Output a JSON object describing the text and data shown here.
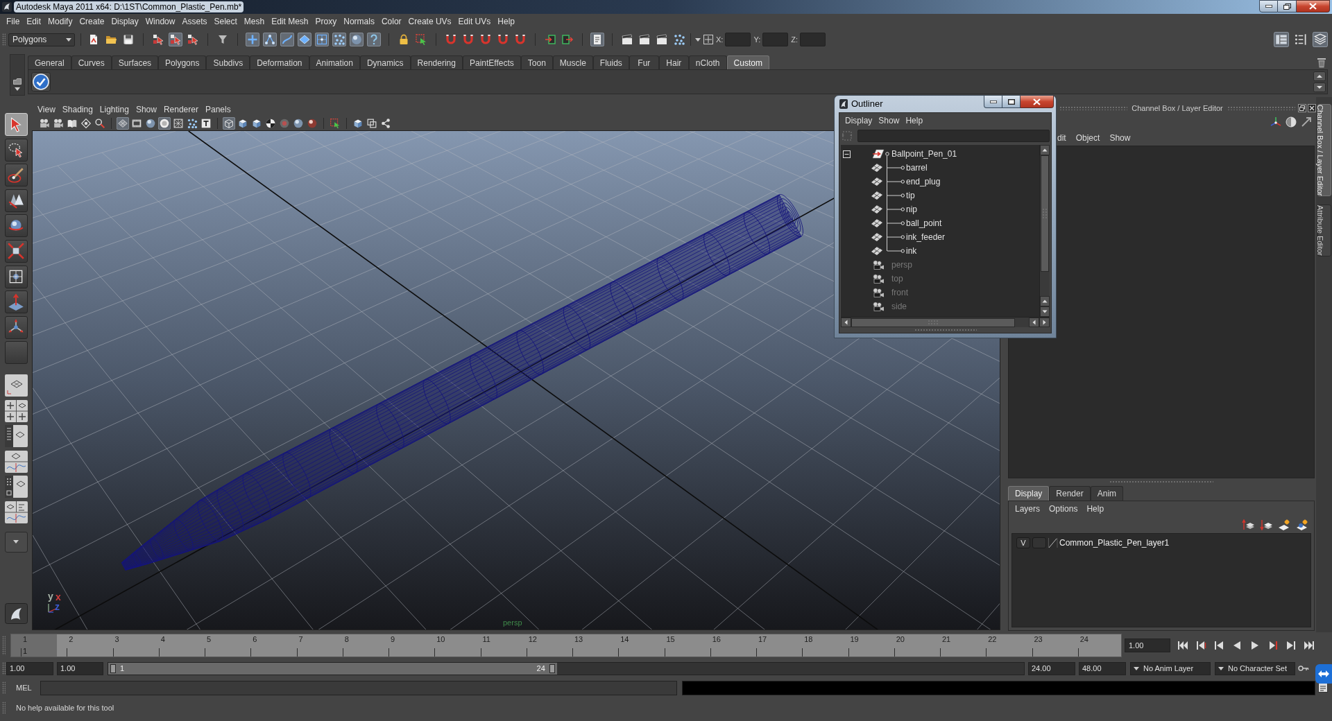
{
  "window": {
    "title": "Autodesk Maya 2011 x64: D:\\1ST\\Common_Plastic_Pen.mb*"
  },
  "menu_bar": [
    "File",
    "Edit",
    "Modify",
    "Create",
    "Display",
    "Window",
    "Assets",
    "Select",
    "Mesh",
    "Edit Mesh",
    "Proxy",
    "Normals",
    "Color",
    "Create UVs",
    "Edit UVs",
    "Help"
  ],
  "status_line": {
    "menu_set": "Polygons",
    "tools": [
      {
        "on": false
      },
      {
        "on": false
      },
      {
        "on": false
      },
      {
        "on": false
      },
      {
        "on": true
      },
      {
        "on": false
      },
      {
        "on": false
      },
      {
        "on": true
      },
      {
        "on": true
      },
      {
        "on": true
      },
      {
        "on": true
      },
      {
        "on": true
      },
      {
        "on": true
      },
      {
        "on": true
      },
      {
        "on": true
      },
      {
        "on": false
      },
      {
        "on": false
      },
      {
        "on": false
      },
      {
        "on": false
      },
      {
        "on": false
      },
      {
        "on": false
      },
      {
        "on": false
      },
      {
        "on": false
      },
      {
        "on": false
      },
      {
        "on": true
      },
      {
        "on": false
      },
      {
        "on": false
      },
      {
        "on": false
      },
      {
        "on": false
      }
    ],
    "coords": [
      "X:",
      "Y:",
      "Z:"
    ],
    "panel_toggles": [
      {
        "on": true
      },
      {
        "on": false
      },
      {
        "on": true
      }
    ]
  },
  "shelf": {
    "tabs": [
      {
        "label": "General",
        "selected": false
      },
      {
        "label": "Curves",
        "selected": false
      },
      {
        "label": "Surfaces",
        "selected": false
      },
      {
        "label": "Polygons",
        "selected": false
      },
      {
        "label": "Subdivs",
        "selected": false
      },
      {
        "label": "Deformation",
        "selected": false
      },
      {
        "label": "Animation",
        "selected": false
      },
      {
        "label": "Dynamics",
        "selected": false
      },
      {
        "label": "Rendering",
        "selected": false
      },
      {
        "label": "PaintEffects",
        "selected": false
      },
      {
        "label": "Toon",
        "selected": false
      },
      {
        "label": "Muscle",
        "selected": false
      },
      {
        "label": "Fluids",
        "selected": false
      },
      {
        "label": "Fur",
        "selected": false
      },
      {
        "label": "Hair",
        "selected": false
      },
      {
        "label": "nCloth",
        "selected": false
      },
      {
        "label": "Custom",
        "selected": true
      }
    ]
  },
  "toolbox": {
    "tools": [
      {
        "selected": true
      },
      {
        "selected": false
      },
      {
        "selected": false
      },
      {
        "selected": false
      },
      {
        "selected": false
      },
      {
        "selected": false
      },
      {
        "selected": false
      },
      {
        "selected": false
      },
      {
        "selected": false
      },
      {
        "selected": false
      }
    ]
  },
  "viewport": {
    "menu": [
      "View",
      "Shading",
      "Lighting",
      "Show",
      "Renderer",
      "Panels"
    ],
    "toolbar": [
      {
        "on": false
      },
      {
        "on": false
      },
      {
        "on": false
      },
      {
        "on": false
      },
      {
        "on": false
      },
      {
        "on": true
      },
      {
        "on": false
      },
      {
        "on": false
      },
      {
        "on": true
      },
      {
        "on": false
      },
      {
        "on": false
      },
      {
        "on": false
      },
      {
        "on": true
      },
      {
        "on": false
      },
      {
        "on": false
      },
      {
        "on": false
      },
      {
        "on": false
      },
      {
        "on": false
      },
      {
        "on": false
      },
      {
        "on": false
      },
      {
        "on": false
      },
      {
        "on": false
      },
      {
        "on": false
      }
    ],
    "camera": "persp",
    "axes": [
      {
        "label": "y",
        "color": "#a8b4a8"
      },
      {
        "label": "x",
        "color": "#d23c3c"
      },
      {
        "label": "z",
        "color": "#3c5ad2"
      }
    ]
  },
  "outliner": {
    "title": "Outliner",
    "menu": [
      "Display",
      "Show",
      "Help"
    ],
    "items": [
      {
        "label": "Ballpoint_Pen_01",
        "kind": "group",
        "expanded": true,
        "hidden": false,
        "children": [
          {
            "label": "barrel",
            "kind": "mesh",
            "hidden": false
          },
          {
            "label": "end_plug",
            "kind": "mesh",
            "hidden": false
          },
          {
            "label": "tip",
            "kind": "mesh",
            "hidden": false
          },
          {
            "label": "nip",
            "kind": "mesh",
            "hidden": false
          },
          {
            "label": "ball_point",
            "kind": "mesh",
            "hidden": false
          },
          {
            "label": "ink_feeder",
            "kind": "mesh",
            "hidden": false
          },
          {
            "label": "ink",
            "kind": "mesh",
            "hidden": false
          }
        ]
      },
      {
        "label": "persp",
        "kind": "camera",
        "hidden": true
      },
      {
        "label": "top",
        "kind": "camera",
        "hidden": true
      },
      {
        "label": "front",
        "kind": "camera",
        "hidden": true
      },
      {
        "label": "side",
        "kind": "camera",
        "hidden": true
      }
    ]
  },
  "channel_box": {
    "title": "Channel Box / Layer Editor",
    "menu": [
      "dit",
      "Object",
      "Show"
    ]
  },
  "layer_editor": {
    "tabs": [
      {
        "label": "Display",
        "selected": true
      },
      {
        "label": "Render",
        "selected": false
      },
      {
        "label": "Anim",
        "selected": false
      }
    ],
    "menu": [
      "Layers",
      "Options",
      "Help"
    ],
    "layers": [
      {
        "visibility": "V",
        "name": "Common_Plastic_Pen_layer1"
      }
    ]
  },
  "side_tabs": [
    {
      "label": "Channel Box / Layer Editor",
      "selected": true
    },
    {
      "label": "Attribute Editor",
      "selected": false
    }
  ],
  "time_slider": {
    "ticks": [
      {
        "label": "1",
        "current": true
      },
      {
        "label": "2",
        "current": false
      },
      {
        "label": "3",
        "current": false
      },
      {
        "label": "4",
        "current": false
      },
      {
        "label": "5",
        "current": false
      },
      {
        "label": "6",
        "current": false
      },
      {
        "label": "7",
        "current": false
      },
      {
        "label": "8",
        "current": false
      },
      {
        "label": "9",
        "current": false
      },
      {
        "label": "10",
        "current": false
      },
      {
        "label": "11",
        "current": false
      },
      {
        "label": "12",
        "current": false
      },
      {
        "label": "13",
        "current": false
      },
      {
        "label": "14",
        "current": false
      },
      {
        "label": "15",
        "current": false
      },
      {
        "label": "16",
        "current": false
      },
      {
        "label": "17",
        "current": false
      },
      {
        "label": "18",
        "current": false
      },
      {
        "label": "19",
        "current": false
      },
      {
        "label": "20",
        "current": false
      },
      {
        "label": "21",
        "current": false
      },
      {
        "label": "22",
        "current": false
      },
      {
        "label": "23",
        "current": false
      },
      {
        "label": "24",
        "current": false
      }
    ],
    "current_frame": "1",
    "current_time": "1.00"
  },
  "range_slider": {
    "start_time": "1.00",
    "playback_start": "1.00",
    "range_start": "1",
    "range_end": "24",
    "level": 0.49,
    "playback_end": "24.00",
    "end_time": "48.00",
    "anim_layer": "No Anim Layer",
    "character_set": "No Character Set"
  },
  "command_line": {
    "language": "MEL"
  },
  "help_line": "No help available for this tool"
}
